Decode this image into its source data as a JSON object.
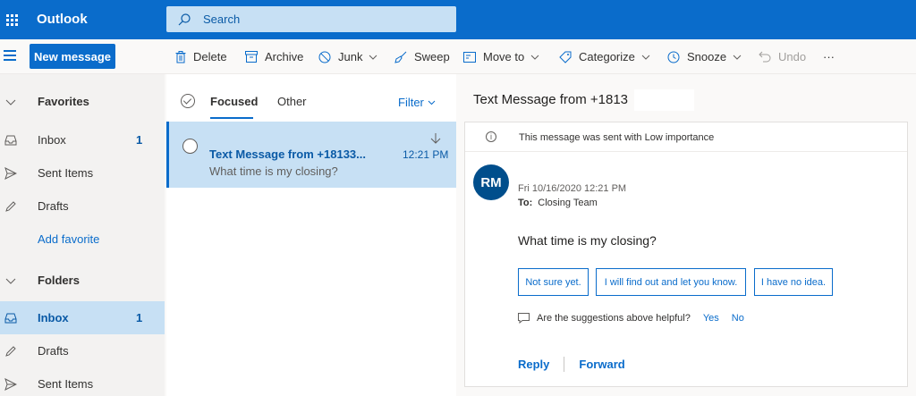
{
  "app": {
    "brand": "Outlook"
  },
  "search": {
    "placeholder": "Search"
  },
  "toolbar": {
    "new_message": "New message",
    "delete": "Delete",
    "archive": "Archive",
    "junk": "Junk",
    "sweep": "Sweep",
    "move_to": "Move to",
    "categorize": "Categorize",
    "snooze": "Snooze",
    "undo": "Undo",
    "more": "···"
  },
  "sidebar": {
    "favorites_label": "Favorites",
    "favorites": [
      {
        "label": "Inbox",
        "count": "1"
      },
      {
        "label": "Sent Items",
        "count": ""
      },
      {
        "label": "Drafts",
        "count": ""
      }
    ],
    "add_favorite": "Add favorite",
    "folders_label": "Folders",
    "folders": [
      {
        "label": "Inbox",
        "count": "1"
      },
      {
        "label": "Drafts",
        "count": ""
      },
      {
        "label": "Sent Items",
        "count": ""
      }
    ]
  },
  "list": {
    "tabs": [
      "Focused",
      "Other"
    ],
    "filter": "Filter",
    "messages": [
      {
        "sender": "Text Message from +18133...",
        "preview": "What time is my closing?",
        "time": "12:21 PM"
      }
    ]
  },
  "reading": {
    "subject": "Text Message from +1813",
    "importance_note": "This message was sent with Low importance",
    "avatar_initials": "RM",
    "date": "Fri 10/16/2020 12:21 PM",
    "to_label": "To:",
    "to": "Closing Team",
    "body": "What time is my closing?",
    "suggestions": [
      "Not sure yet.",
      "I will find out and let you know.",
      "I have no idea."
    ],
    "helpful_question": "Are the suggestions above helpful?",
    "yes": "Yes",
    "no": "No",
    "reply": "Reply",
    "forward": "Forward"
  },
  "colors": {
    "accent": "#0a6ccb",
    "selected_bg": "#c7e0f4",
    "avatar": "#004e8c"
  }
}
